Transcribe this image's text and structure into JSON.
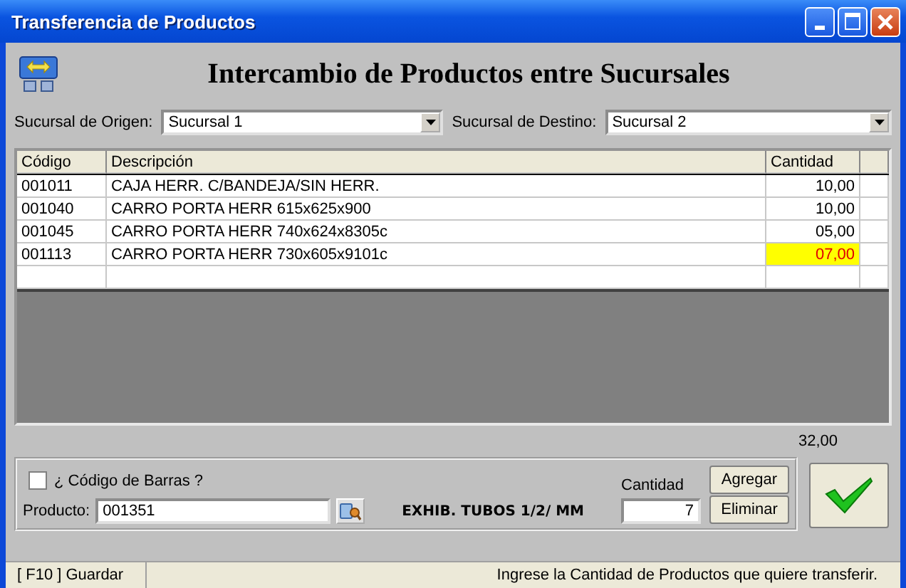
{
  "window": {
    "title": "Transferencia de Productos"
  },
  "heading": "Intercambio de Productos entre Sucursales",
  "origin": {
    "label": "Sucursal de Origen:",
    "value": "Sucursal 1"
  },
  "destination": {
    "label": "Sucursal de Destino:",
    "value": "Sucursal 2"
  },
  "table": {
    "columns": [
      "Código",
      "Descripción",
      "Cantidad"
    ],
    "rows": [
      {
        "cells": [
          "001011",
          "CAJA HERR. C/BANDEJA/SIN HERR.",
          "10,00"
        ],
        "highlighted": false
      },
      {
        "cells": [
          "001040",
          "CARRO PORTA HERR 615x625x900",
          "10,00"
        ],
        "highlighted": false
      },
      {
        "cells": [
          "001045",
          "CARRO PORTA HERR 740x624x8305c",
          "05,00"
        ],
        "highlighted": false
      },
      {
        "cells": [
          "001113",
          "CARRO PORTA HERR 730x605x9101c",
          "07,00"
        ],
        "highlighted": true
      }
    ]
  },
  "total": "32,00",
  "barcode": {
    "label": "¿ Código de Barras ?",
    "checked": false
  },
  "product": {
    "label": "Producto:",
    "value": "001351",
    "description": "EXHIB. TUBOS 1/2/ MM"
  },
  "quantity": {
    "label": "Cantidad",
    "value": "7"
  },
  "buttons": [
    "Agregar",
    "Eliminar"
  ],
  "status_bar": {
    "left": "[ F10 ] Guardar",
    "right": "Ingrese la Cantidad de Productos que quiere transferir."
  }
}
